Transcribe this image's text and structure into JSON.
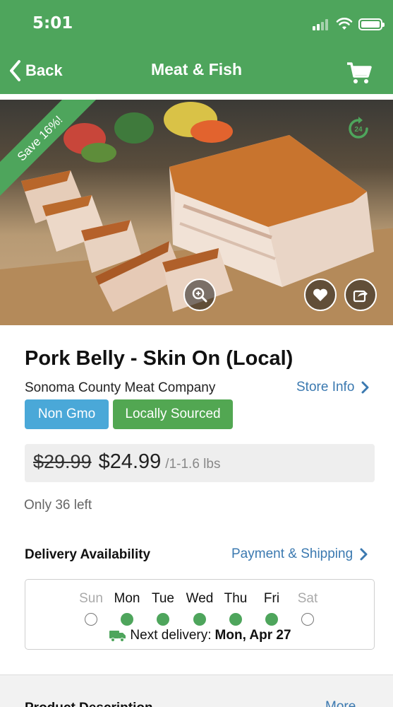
{
  "status_bar": {
    "time": "5:01"
  },
  "nav": {
    "back_label": "Back",
    "title": "Meat & Fish"
  },
  "hero": {
    "badge": "Save 16%!",
    "timer_label": "24"
  },
  "product": {
    "name": "Pork Belly - Skin On (Local)",
    "vendor": "Sonoma County Meat Company",
    "store_info_label": "Store Info",
    "tags": [
      "Non Gmo",
      "Locally Sourced"
    ],
    "price_old": "$29.99",
    "price_new": "$24.99",
    "price_unit": "/1-1.6 lbs",
    "stock": "Only 36 left"
  },
  "delivery": {
    "title": "Delivery Availability",
    "payment_label": "Payment & Shipping",
    "days": [
      {
        "label": "Sun",
        "available": false
      },
      {
        "label": "Mon",
        "available": true
      },
      {
        "label": "Tue",
        "available": true
      },
      {
        "label": "Wed",
        "available": true
      },
      {
        "label": "Thu",
        "available": true
      },
      {
        "label": "Fri",
        "available": true
      },
      {
        "label": "Sat",
        "available": false
      }
    ],
    "next_prefix": "Next delivery:",
    "next_date": "Mon, Apr 27"
  },
  "description": {
    "title": "Product Description",
    "more_label": "More"
  },
  "colors": {
    "brand": "#4ea55c",
    "link": "#3b79b0",
    "tag_blue": "#4aa8d8",
    "tag_green": "#52a752"
  }
}
